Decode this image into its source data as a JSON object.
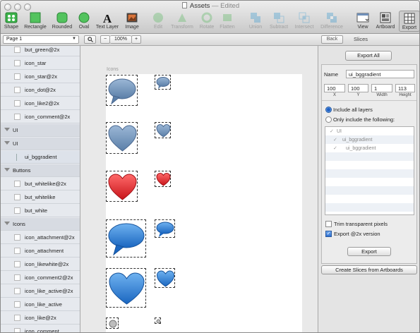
{
  "window": {
    "title": "Assets",
    "status": "Edited"
  },
  "toolbar": {
    "items": [
      {
        "label": "Shape",
        "icon": "shape-icon",
        "enabled": true
      },
      {
        "label": "Rectangle",
        "icon": "rectangle-icon",
        "enabled": true
      },
      {
        "label": "Rounded",
        "icon": "rounded-rect-icon",
        "enabled": true
      },
      {
        "label": "Oval",
        "icon": "oval-icon",
        "enabled": true
      },
      {
        "label": "Text Layer",
        "icon": "text-icon",
        "enabled": true
      },
      {
        "label": "Image",
        "icon": "image-icon",
        "enabled": true
      },
      {
        "label": "Edit",
        "icon": "edit-icon",
        "enabled": false
      },
      {
        "label": "Transform",
        "icon": "transform-icon",
        "enabled": false
      },
      {
        "label": "Rotate",
        "icon": "rotate-icon",
        "enabled": false
      },
      {
        "label": "Flatten",
        "icon": "flatten-icon",
        "enabled": false
      },
      {
        "label": "Union",
        "icon": "union-icon",
        "enabled": false
      },
      {
        "label": "Subtract",
        "icon": "subtract-icon",
        "enabled": false
      },
      {
        "label": "Intersect",
        "icon": "intersect-icon",
        "enabled": false
      },
      {
        "label": "Difference",
        "icon": "difference-icon",
        "enabled": false
      },
      {
        "label": "View",
        "icon": "view-icon",
        "enabled": true
      },
      {
        "label": "Artboard",
        "icon": "artboard-icon",
        "enabled": true
      },
      {
        "label": "Export",
        "icon": "export-icon",
        "enabled": true
      }
    ]
  },
  "subbar": {
    "page": "Page 1",
    "zoom_out": "−",
    "zoom": "100%",
    "zoom_in": "+",
    "back": "Back",
    "panel_title": "Slices"
  },
  "sidebar": {
    "rows": [
      {
        "label": "but_green@2x",
        "kind": "item"
      },
      {
        "label": "icon_star",
        "kind": "item"
      },
      {
        "label": "icon_star@2x",
        "kind": "item"
      },
      {
        "label": "icon_dot@2x",
        "kind": "item"
      },
      {
        "label": "icon_like2@2x",
        "kind": "item"
      },
      {
        "label": "icon_comment@2x",
        "kind": "item"
      },
      {
        "label": "UI",
        "kind": "group"
      },
      {
        "label": "UI",
        "kind": "group"
      },
      {
        "label": "ui_bggradient",
        "kind": "selected"
      },
      {
        "label": "Buttons",
        "kind": "group"
      },
      {
        "label": "but_whitelike@2x",
        "kind": "item"
      },
      {
        "label": "but_whitelike",
        "kind": "item"
      },
      {
        "label": "but_white",
        "kind": "item"
      },
      {
        "label": "Icons",
        "kind": "group"
      },
      {
        "label": "icon_attachment@2x",
        "kind": "item"
      },
      {
        "label": "icon_attachment",
        "kind": "item"
      },
      {
        "label": "icon_likewhite@2x",
        "kind": "item"
      },
      {
        "label": "icon_comment2@2x",
        "kind": "item"
      },
      {
        "label": "icon_like_active@2x",
        "kind": "item"
      },
      {
        "label": "icon_like_active",
        "kind": "item"
      },
      {
        "label": "icon_like@2x",
        "kind": "item"
      },
      {
        "label": "icon_comment",
        "kind": "item"
      }
    ]
  },
  "canvas": {
    "artboard_label": "Icons",
    "colors": {
      "grey_blue": "#6b8fb8",
      "red": "#e8262a",
      "blue": "#2a7fd4"
    }
  },
  "inspector": {
    "export_all": "Export All",
    "name_label": "Name",
    "name_value": "ui_bggradient",
    "x_value": "100",
    "y_value": "100",
    "width_value": "1",
    "height_value": "113",
    "x_caption": "X",
    "y_caption": "Y",
    "width_caption": "Width",
    "height_caption": "Height",
    "include_all": "Include all layers",
    "only_include": "Only include the following:",
    "layers": [
      "UI",
      "ui_bggradient",
      "ui_bggradient"
    ],
    "trim_label": "Trim transparent pixels",
    "export2x_label": "Export @2x version",
    "export_button": "Export",
    "create_slices": "Create Slices from Artboards"
  }
}
